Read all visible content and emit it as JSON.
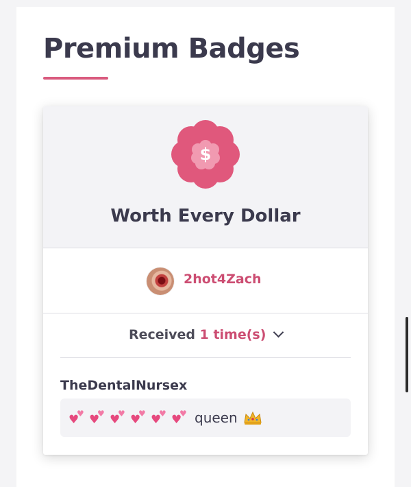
{
  "page": {
    "title": "Premium Badges"
  },
  "badge": {
    "name": "Worth Every Dollar",
    "icon": "dollar-flower-badge-icon",
    "icon_symbol": "$",
    "colors": {
      "outer": "#e0587c",
      "inner": "#f19ab1",
      "accent": "#cc4d72"
    }
  },
  "sender": {
    "username": "2hot4Zach"
  },
  "received": {
    "prefix": "Received",
    "count_text": "1 time(s)"
  },
  "gift": {
    "from": "TheDentalNursex",
    "message_text": "queen",
    "emoji": {
      "hearts": "two-hearts-emoji",
      "heart_count": 6,
      "crown": "crown-emoji"
    }
  }
}
